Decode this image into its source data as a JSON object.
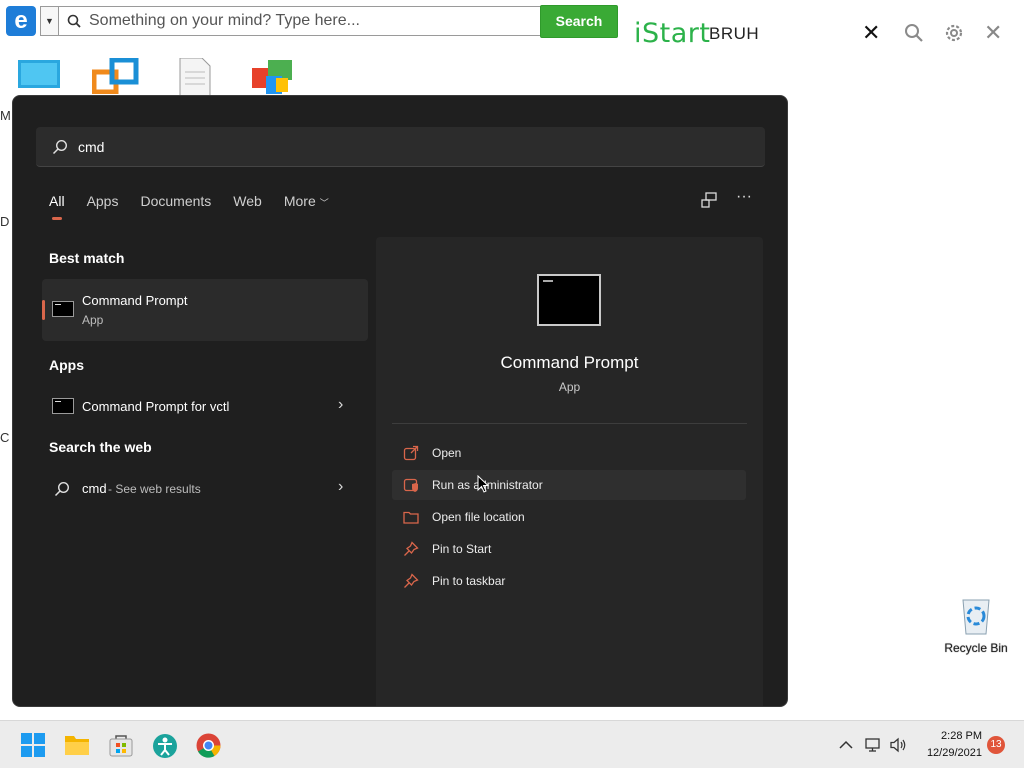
{
  "toolbar": {
    "search_placeholder": "Something on your mind? Type here...",
    "search_button": "Search",
    "logo_text": "iStart",
    "user_label": "BRUH"
  },
  "desktop": {
    "fragments": [
      "M",
      "D",
      "C"
    ],
    "recycle_bin_label": "Recycle Bin"
  },
  "start_menu": {
    "search_value": "cmd",
    "tabs": [
      "All",
      "Apps",
      "Documents",
      "Web",
      "More"
    ],
    "sections": {
      "best_match": "Best match",
      "apps": "Apps",
      "search_web": "Search the web"
    },
    "best_match_item": {
      "title": "Command Prompt",
      "subtitle": "App"
    },
    "apps_items": [
      {
        "title": "Command Prompt for vctl"
      }
    ],
    "web_item": {
      "query": "cmd",
      "suffix": " - See web results"
    },
    "preview": {
      "title": "Command Prompt",
      "subtitle": "App",
      "actions": [
        "Open",
        "Run as administrator",
        "Open file location",
        "Pin to Start",
        "Pin to taskbar"
      ]
    }
  },
  "taskbar": {
    "time": "2:28 PM",
    "date": "12/29/2021",
    "notifications": "13"
  },
  "colors": {
    "accent": "#d9664b",
    "menu_bg": "#1f1f1f",
    "istart_green": "#2cb24a",
    "search_green": "#3aaa35"
  }
}
